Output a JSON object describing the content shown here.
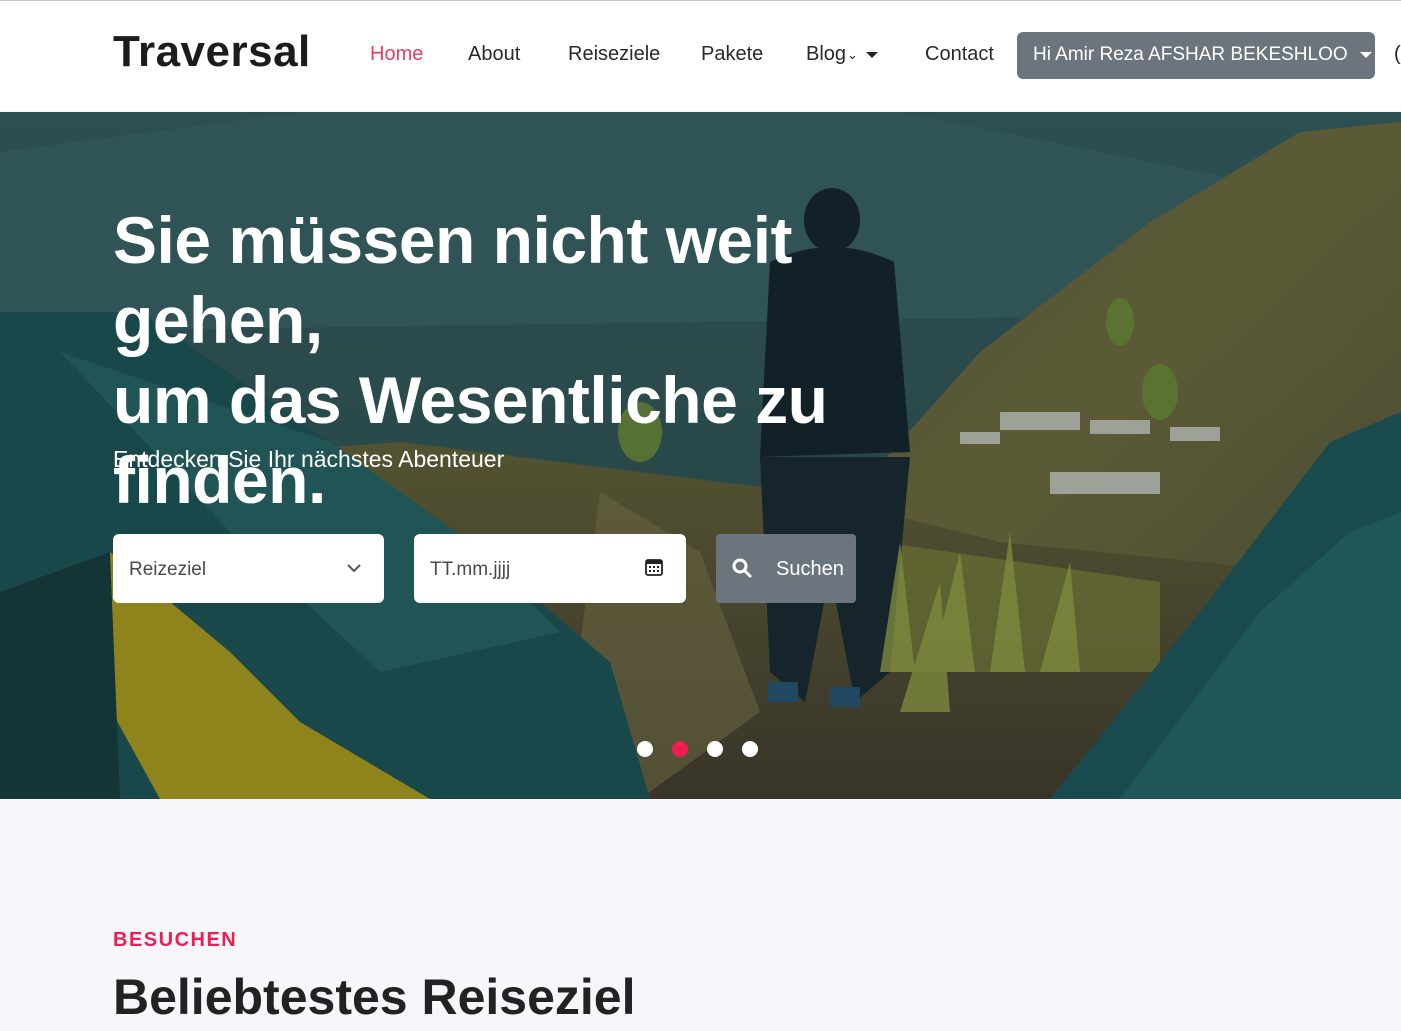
{
  "brand": {
    "logo": "Traversal"
  },
  "nav": {
    "items": [
      {
        "label": "Home",
        "active": true
      },
      {
        "label": "About"
      },
      {
        "label": "Reiseziele"
      },
      {
        "label": "Pakete"
      },
      {
        "label": "Blog"
      },
      {
        "label": "Contact"
      }
    ],
    "blog_chevron": "⌄",
    "user_menu": "Hi Amir Reza AFSHAR BEKESHLOO",
    "edge_fragment": "("
  },
  "hero": {
    "headline_lines": [
      "Sie müssen nicht weit gehen,",
      "um das Wesentliche zu",
      "finden."
    ],
    "subtitle": "Entdecken Sie Ihr nächstes Abenteuer",
    "destination_placeholder": "Reizeziel",
    "date_placeholder": "TT.mm.jjjj",
    "search_label": "Suchen",
    "carousel": {
      "slide_count": 4,
      "active_index": 1
    }
  },
  "section": {
    "kicker": "BESUCHEN",
    "title": "Beliebtestes Reiseziel"
  },
  "colors": {
    "accent": "#ee1d52",
    "nav_active": "#ee3b63",
    "button_gray": "#6c757d"
  },
  "icons": {
    "destination_dropdown": "chevron-down-icon",
    "date_field": "calendar-icon",
    "search": "search-icon"
  }
}
